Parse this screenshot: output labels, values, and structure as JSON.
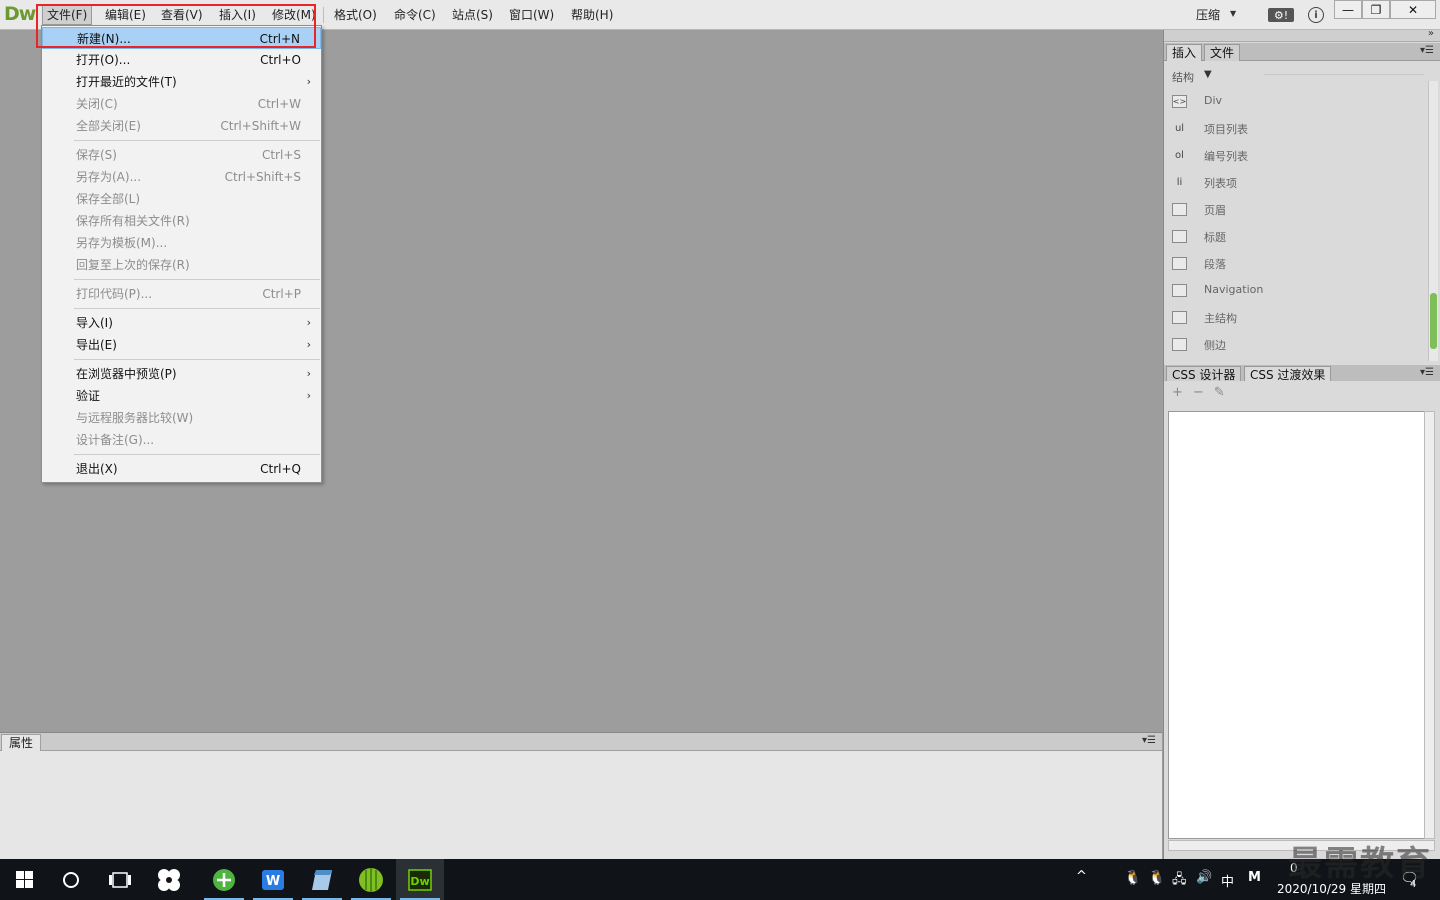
{
  "app": {
    "logo": "Dw"
  },
  "menu": [
    {
      "label": "文件(F)",
      "active": true
    },
    {
      "label": "编辑(E)"
    },
    {
      "label": "查看(V)"
    },
    {
      "label": "插入(I)"
    },
    {
      "label": "修改(M)"
    },
    {
      "label": "格式(O)"
    },
    {
      "label": "命令(C)"
    },
    {
      "label": "站点(S)"
    },
    {
      "label": "窗口(W)"
    },
    {
      "label": "帮助(H)"
    }
  ],
  "toolbar": {
    "compress_label": "压缩"
  },
  "file_menu": [
    {
      "label": "新建(N)...",
      "shortcut": "Ctrl+N",
      "selected": true
    },
    {
      "label": "打开(O)...",
      "shortcut": "Ctrl+O"
    },
    {
      "label": "打开最近的文件(T)",
      "shortcut": "",
      "submenu": true
    },
    {
      "label": "关闭(C)",
      "shortcut": "Ctrl+W",
      "disabled": true
    },
    {
      "label": "全部关闭(E)",
      "shortcut": "Ctrl+Shift+W",
      "disabled": true
    },
    {
      "label": "保存(S)",
      "shortcut": "Ctrl+S",
      "disabled": true
    },
    {
      "label": "另存为(A)...",
      "shortcut": "Ctrl+Shift+S",
      "disabled": true
    },
    {
      "label": "保存全部(L)",
      "shortcut": "",
      "disabled": true
    },
    {
      "label": "保存所有相关文件(R)",
      "shortcut": "",
      "disabled": true
    },
    {
      "label": "另存为模板(M)...",
      "shortcut": "",
      "disabled": true
    },
    {
      "label": "回复至上次的保存(R)",
      "shortcut": "",
      "disabled": true
    },
    {
      "label": "打印代码(P)...",
      "shortcut": "Ctrl+P",
      "disabled": true
    },
    {
      "label": "导入(I)",
      "shortcut": "",
      "submenu": true
    },
    {
      "label": "导出(E)",
      "shortcut": "",
      "submenu": true
    },
    {
      "label": "在浏览器中预览(P)",
      "shortcut": "",
      "submenu": true
    },
    {
      "label": "验证",
      "shortcut": "",
      "submenu": true
    },
    {
      "label": "与远程服务器比较(W)",
      "shortcut": "",
      "disabled": true
    },
    {
      "label": "设计备注(G)...",
      "shortcut": "",
      "disabled": true
    },
    {
      "label": "退出(X)",
      "shortcut": "Ctrl+Q"
    }
  ],
  "properties_panel": {
    "tab": "属性"
  },
  "insert_panel": {
    "tabs": [
      "插入",
      "文件"
    ],
    "category": "结构",
    "items": [
      {
        "icon": "div-icon",
        "glyph": "<>",
        "label": "Div"
      },
      {
        "icon": "ul-icon",
        "glyph": "ul",
        "label": "项目列表"
      },
      {
        "icon": "ol-icon",
        "glyph": "ol",
        "label": "编号列表"
      },
      {
        "icon": "li-icon",
        "glyph": "li",
        "label": "列表项"
      },
      {
        "icon": "header-icon",
        "glyph": "",
        "label": "页眉"
      },
      {
        "icon": "heading-icon",
        "glyph": "",
        "label": "标题"
      },
      {
        "icon": "paragraph-icon",
        "glyph": "",
        "label": "段落"
      },
      {
        "icon": "nav-icon",
        "glyph": "",
        "label": "Navigation"
      },
      {
        "icon": "main-icon",
        "glyph": "",
        "label": "主结构"
      },
      {
        "icon": "aside-icon",
        "glyph": "",
        "label": "侧边"
      }
    ]
  },
  "css_panel": {
    "tabs": [
      "CSS 设计器",
      "CSS 过渡效果"
    ]
  },
  "taskbar": {
    "ime": "中",
    "clock_time": "0",
    "clock_date": "2020/10/29 星期四",
    "notification_count": "4"
  },
  "watermark": "最需教育"
}
